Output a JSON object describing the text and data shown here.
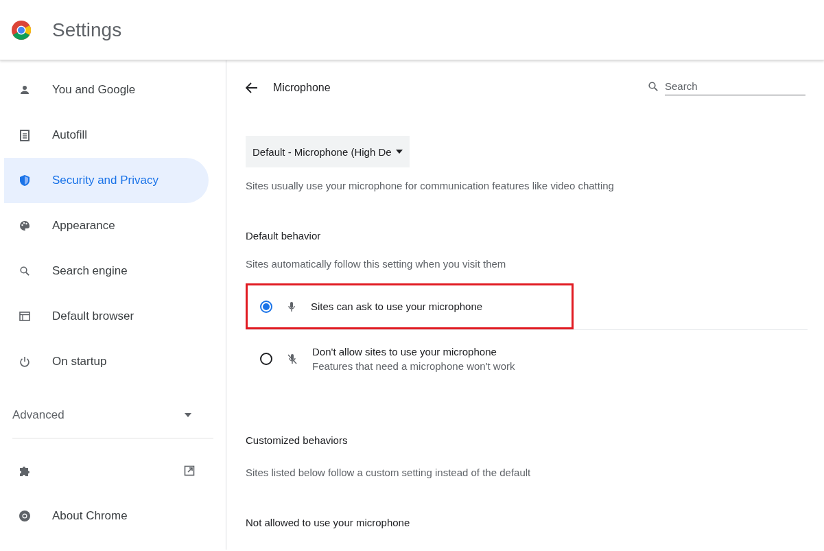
{
  "header": {
    "title": "Settings"
  },
  "sidebar": {
    "items": [
      {
        "kind": "person",
        "label": "You and Google",
        "selected": false
      },
      {
        "kind": "clipboard",
        "label": "Autofill",
        "selected": false
      },
      {
        "kind": "shield",
        "label": "Security and Privacy",
        "selected": true
      },
      {
        "kind": "palette",
        "label": "Appearance",
        "selected": false
      },
      {
        "kind": "search",
        "label": "Search engine",
        "selected": false
      },
      {
        "kind": "browser",
        "label": "Default browser",
        "selected": false
      },
      {
        "kind": "power",
        "label": "On startup",
        "selected": false
      }
    ],
    "advanced": {
      "label": "Advanced",
      "expanded": false
    },
    "extra_items": [
      {
        "kind": "puzzle",
        "external": true
      },
      {
        "kind": "chrome",
        "label": "About Chrome",
        "external": false
      }
    ]
  },
  "main": {
    "title": "Microphone",
    "search": {
      "placeholder": "Search"
    },
    "device_dropdown": {
      "value": "Default - Microphone (High De"
    },
    "device_note": "Sites usually use your microphone for communication features like video chatting",
    "default_behavior": {
      "heading": "Default behavior",
      "description": "Sites automatically follow this setting when you visit them",
      "options": [
        {
          "kind": "allow",
          "label": "Sites can ask to use your microphone",
          "selected": true,
          "highlighted": true
        },
        {
          "kind": "block",
          "label": "Don't allow sites to use your microphone",
          "sublabel": "Features that need a microphone won't work",
          "selected": false,
          "highlighted": false
        }
      ]
    },
    "customized": {
      "heading": "Customized behaviors",
      "description": "Sites listed below follow a custom setting instead of the default"
    },
    "not_allowed": {
      "heading": "Not allowed to use your microphone"
    }
  }
}
